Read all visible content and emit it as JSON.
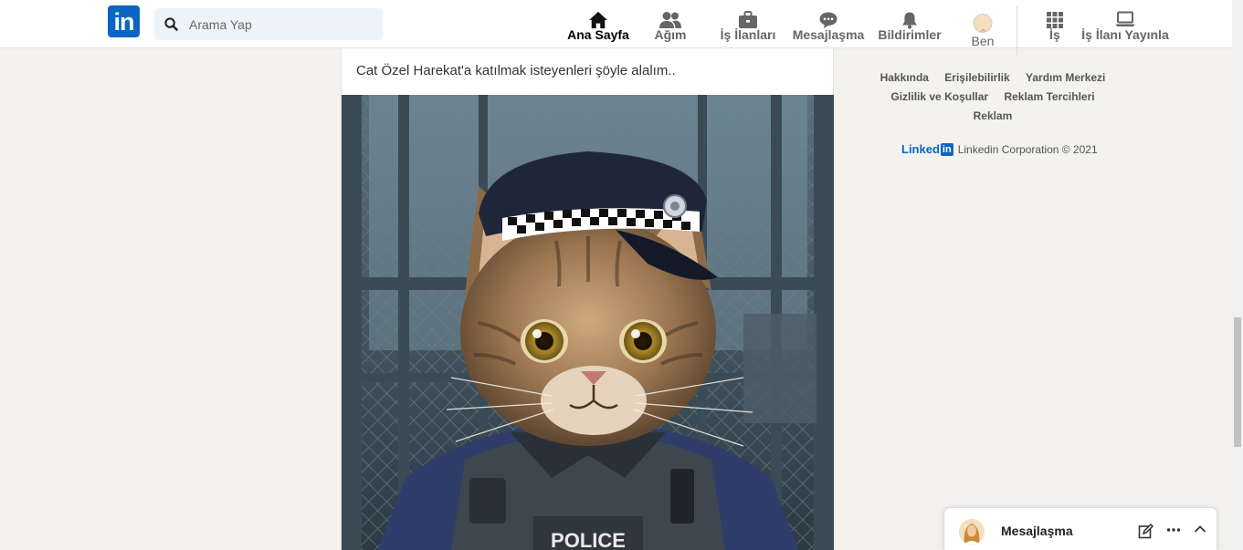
{
  "nav": {
    "logo_text": "in",
    "search_placeholder": "Arama Yap",
    "items": [
      {
        "label": "Ana Sayfa",
        "icon": "home-icon"
      },
      {
        "label": "Ağım",
        "icon": "network-icon"
      },
      {
        "label": "İş İlanları",
        "icon": "briefcase-icon"
      },
      {
        "label": "Mesajlaşma",
        "icon": "chat-icon"
      },
      {
        "label": "Bildirimler",
        "icon": "bell-icon"
      },
      {
        "label": "Ben",
        "icon": "avatar"
      },
      {
        "label": "İş",
        "icon": "grid-icon"
      },
      {
        "label": "İş İlanı Yayınla",
        "icon": "laptop-icon"
      }
    ]
  },
  "post": {
    "text": "Cat Özel Harekat'a katılmak isteyenleri şöyle alalım..",
    "image_badge_text": "POLICE"
  },
  "footer": {
    "links_row1": [
      "Hakkında",
      "Erişilebilirlik",
      "Yardım Merkezi"
    ],
    "links_row2": [
      "Gizlilik ve Koşullar",
      "Reklam Tercihleri"
    ],
    "links_row3": [
      "Reklam"
    ],
    "brand_word": "Linked",
    "brand_in": "in",
    "copyright": "Linkedin Corporation © 2021"
  },
  "messaging": {
    "title": "Mesajlaşma"
  },
  "colors": {
    "brand": "#0a66c2",
    "page_bg": "#f3f2ef"
  }
}
